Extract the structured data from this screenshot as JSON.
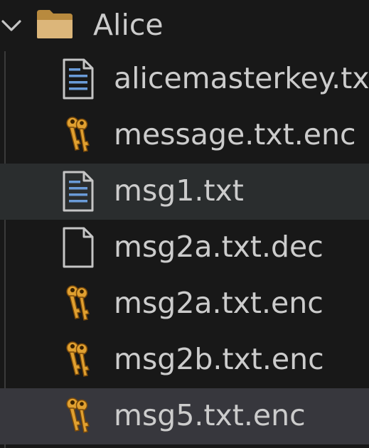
{
  "explorer": {
    "folder": {
      "name": "Alice",
      "expanded": true,
      "icon": "folder-open-icon",
      "icon_color": "#dcb67a"
    },
    "files": [
      {
        "name": "alicemasterkey.txt",
        "icon": "text-file-icon",
        "state": "normal"
      },
      {
        "name": "message.txt.enc",
        "icon": "keys-icon",
        "state": "normal"
      },
      {
        "name": "msg1.txt",
        "icon": "text-file-icon",
        "state": "hover"
      },
      {
        "name": "msg2a.txt.dec",
        "icon": "blank-file-icon",
        "state": "normal"
      },
      {
        "name": "msg2a.txt.enc",
        "icon": "keys-icon",
        "state": "normal"
      },
      {
        "name": "msg2b.txt.enc",
        "icon": "keys-icon",
        "state": "normal"
      },
      {
        "name": "msg5.txt.enc",
        "icon": "keys-icon",
        "state": "selected"
      }
    ],
    "colors": {
      "background": "#181818",
      "hover_row": "#2a2d2e",
      "selected_row": "#37373d",
      "text": "#cccccc",
      "text_file_lines": "#6a9bd8",
      "key_gold": "#e0a030"
    }
  }
}
